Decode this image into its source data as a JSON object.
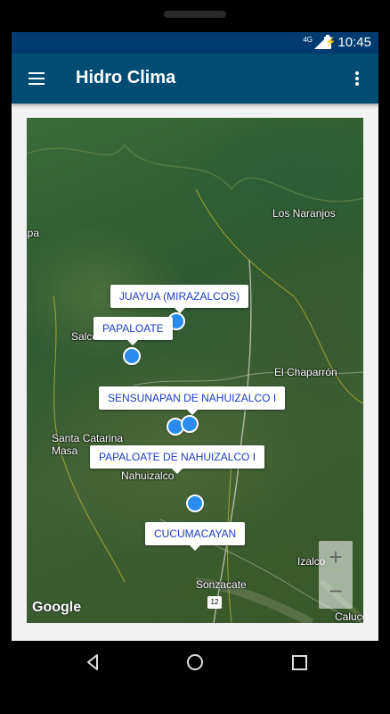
{
  "status_bar": {
    "network": "4G",
    "time": "10:45"
  },
  "app_bar": {
    "title": "Hidro Clima"
  },
  "map": {
    "place_labels": {
      "los_naranjos": "Los Naranjos",
      "apa": "apa",
      "salcoatitan": "Salco",
      "el_chaparron": "El Chaparrón",
      "santa_catarina": "Santa Catarina",
      "masahuat": "Masa",
      "nahuizalco": "Nahuizalco",
      "izalco": "Izalco",
      "sonzacate": "Sonzacate",
      "caluco": "Caluco"
    },
    "road_shield": "12",
    "stations": [
      "JUAYUA (MIRAZALCOS)",
      "PAPALOATE",
      "SENSUNAPAN DE NAHUIZALCO I",
      "PAPALOATE DE NAHUIZALCO I",
      "CUCUMACAYAN"
    ],
    "zoom_in": "+",
    "zoom_out": "−",
    "attribution": "Google"
  },
  "colors": {
    "status_bar": "#013b6f",
    "app_bar": "#004c73",
    "marker": "#2b8cf0",
    "callout_text": "#1a3cc4"
  }
}
